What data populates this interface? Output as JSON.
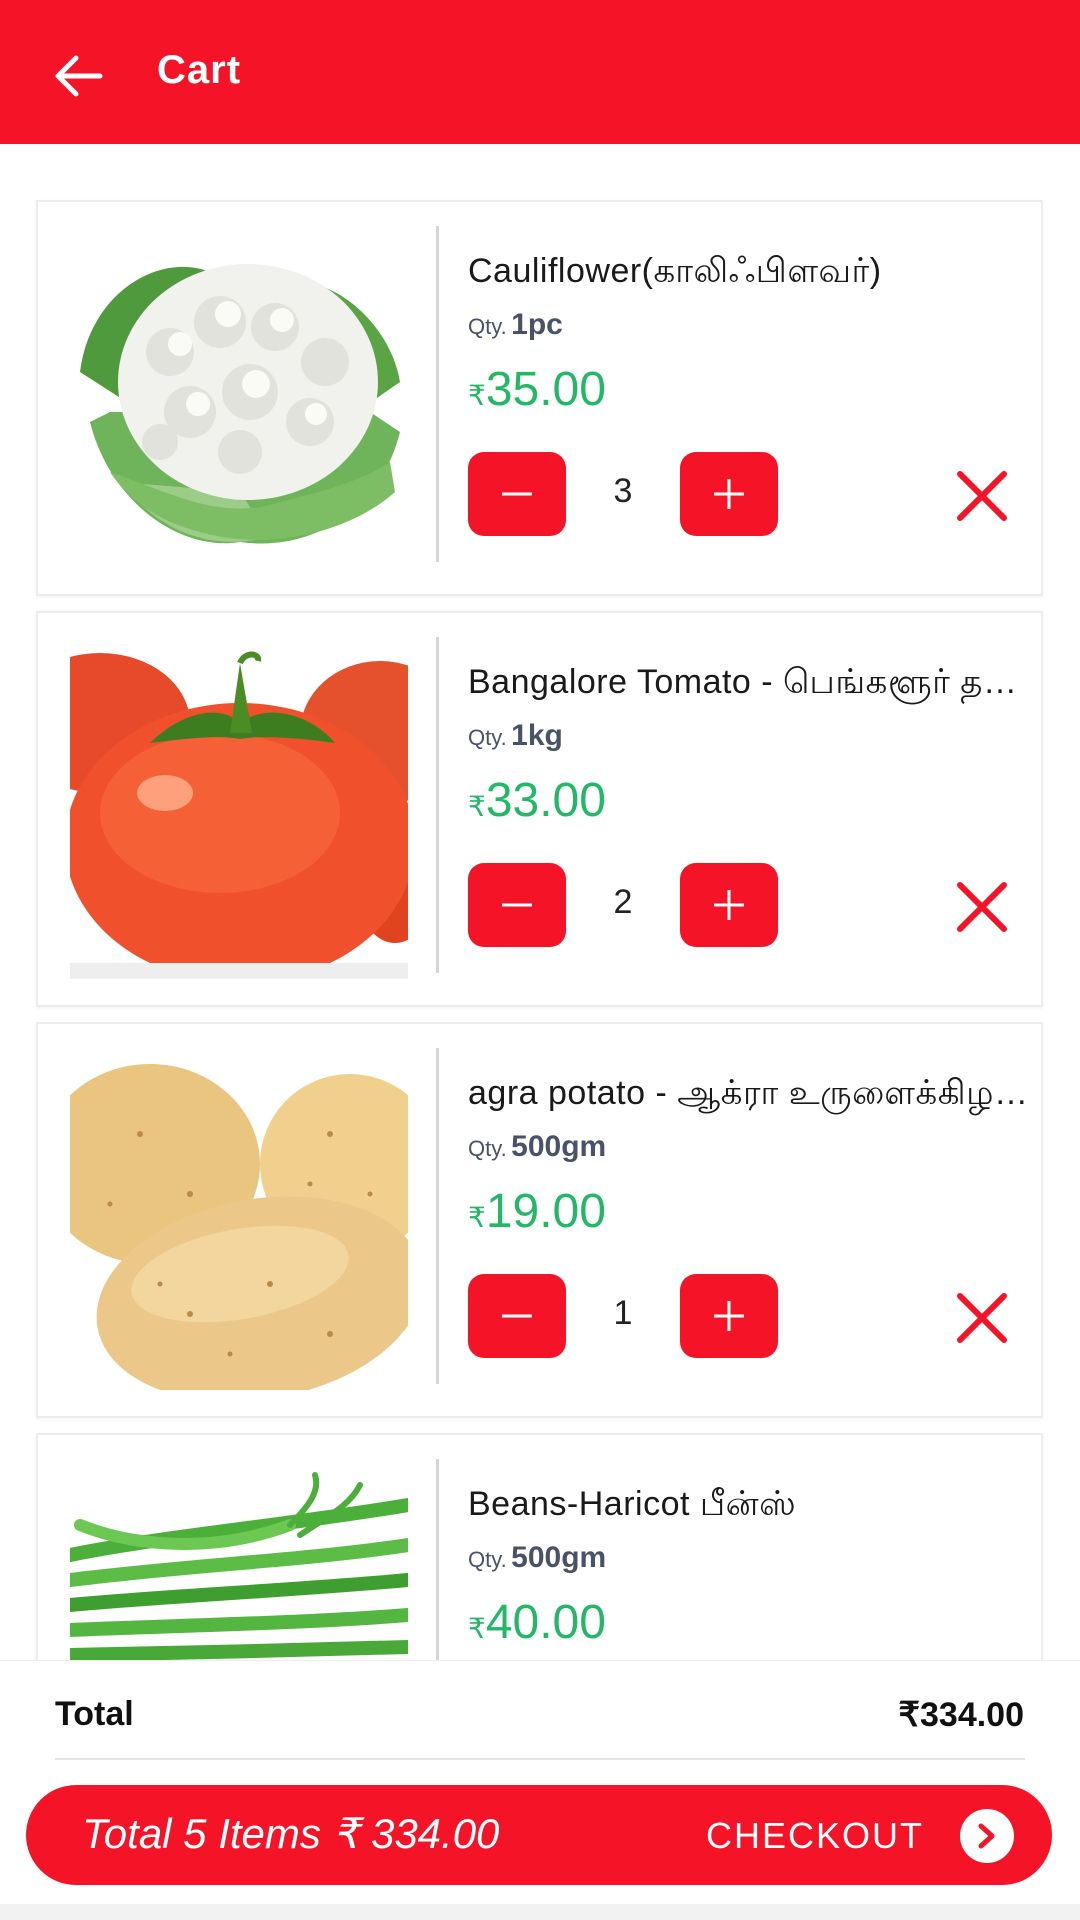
{
  "appbar": {
    "title": "Cart"
  },
  "currency_symbol": "₹",
  "qty_label": "Qty.",
  "items": [
    {
      "name": "Cauliflower(காலிஃபிளவர்)",
      "qty": "1pc",
      "price": "35.00",
      "count": "3",
      "image": "cauliflower"
    },
    {
      "name": "Bangalore Tomato - பெங்களூர் தக்காளி",
      "qty": "1kg",
      "price": "33.00",
      "count": "2",
      "image": "tomato"
    },
    {
      "name": "agra potato - ஆக்ரா உருளைக்கிழங்கு",
      "qty": "500gm",
      "price": "19.00",
      "count": "1",
      "image": "potato"
    },
    {
      "name": "Beans-Haricot பீன்ஸ்",
      "qty": "500gm",
      "price": "40.00",
      "count": "",
      "image": "beans"
    }
  ],
  "footer": {
    "total_label": "Total",
    "total_value": "₹334.00",
    "checkout_summary": "Total 5 Items ₹ 334.00",
    "checkout_label": "CHECKOUT"
  },
  "colors": {
    "accent": "#f51427",
    "price": "#22b866",
    "qty": "#4a5268"
  }
}
